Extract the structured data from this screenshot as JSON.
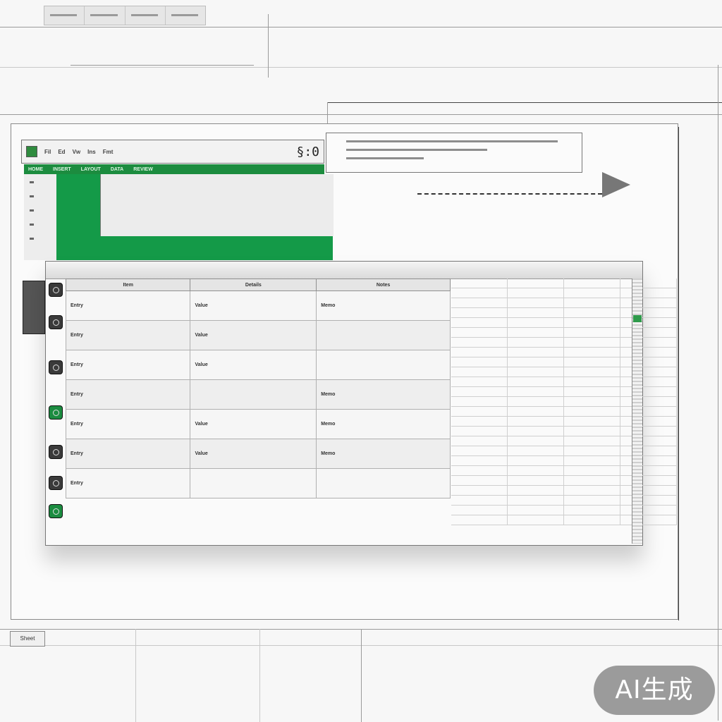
{
  "app": {
    "title_icons": "§:0",
    "menu": [
      "Fil",
      "Ed",
      "Vw",
      "Ins",
      "Fmt"
    ]
  },
  "ribbon": {
    "tabs": [
      "HOME",
      "INSERT",
      "LAYOUT",
      "DATA",
      "REVIEW"
    ]
  },
  "sheet": {
    "columns": [
      "Item",
      "Details",
      "Notes"
    ],
    "rows": [
      [
        "Entry",
        "Value",
        "Memo"
      ],
      [
        "Entry",
        "Value",
        ""
      ],
      [
        "Entry",
        "Value",
        ""
      ],
      [
        "Entry",
        "",
        "Memo"
      ],
      [
        "Entry",
        "Value",
        "Memo"
      ],
      [
        "Entry",
        "Value",
        "Memo"
      ],
      [
        "Entry",
        "",
        ""
      ]
    ]
  },
  "footer": {
    "label": "Sheet"
  },
  "watermark": "AI生成"
}
